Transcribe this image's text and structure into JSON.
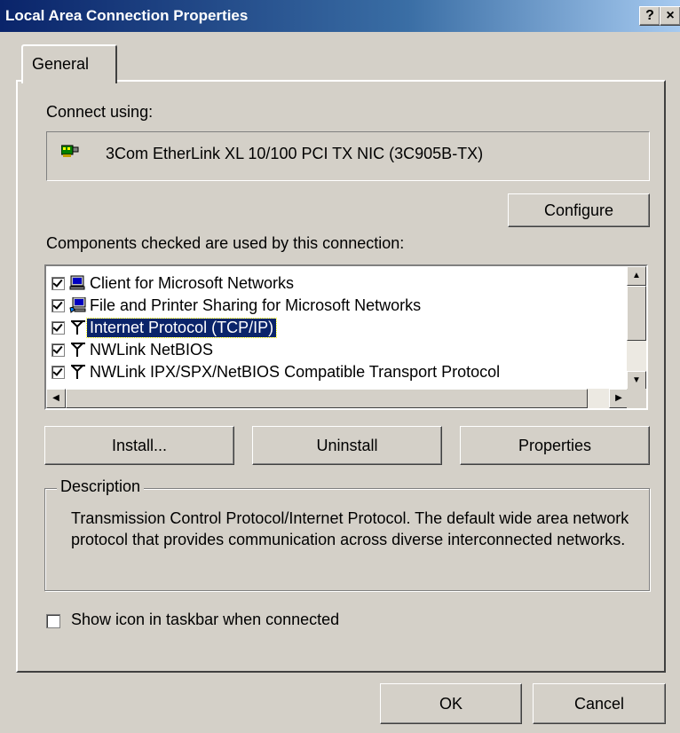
{
  "window": {
    "title": "Local Area Connection Properties",
    "help_button": "?",
    "close_button": "×"
  },
  "tabs": [
    {
      "label": "General",
      "active": true
    }
  ],
  "connect_using": {
    "label": "Connect using:",
    "adapter": "3Com EtherLink XL 10/100 PCI TX NIC (3C905B-TX)",
    "configure_button": "Configure"
  },
  "components": {
    "label": "Components checked are used by this connection:",
    "items": [
      {
        "label": "Client for Microsoft Networks",
        "checked": true,
        "icon": "network-client-icon"
      },
      {
        "label": "File and Printer Sharing for Microsoft Networks",
        "checked": true,
        "icon": "file-printer-sharing-icon"
      },
      {
        "label": "Internet Protocol (TCP/IP)",
        "checked": true,
        "icon": "protocol-icon",
        "selected": true
      },
      {
        "label": "NWLink NetBIOS",
        "checked": true,
        "icon": "protocol-icon"
      },
      {
        "label": "NWLink IPX/SPX/NetBIOS Compatible Transport Protocol",
        "checked": true,
        "icon": "protocol-icon"
      }
    ],
    "buttons": {
      "install": "Install...",
      "uninstall": "Uninstall",
      "properties": "Properties"
    }
  },
  "description": {
    "legend": "Description",
    "text": "Transmission Control Protocol/Internet Protocol. The default wide area network protocol that provides communication across diverse interconnected networks."
  },
  "taskbar_checkbox": {
    "label": "Show icon in taskbar when connected",
    "checked": false
  },
  "footer": {
    "ok": "OK",
    "cancel": "Cancel"
  },
  "colors": {
    "title_start": "#0a246a",
    "title_end": "#a6caf0",
    "face": "#d4d0c8",
    "selection": "#0a246a"
  }
}
